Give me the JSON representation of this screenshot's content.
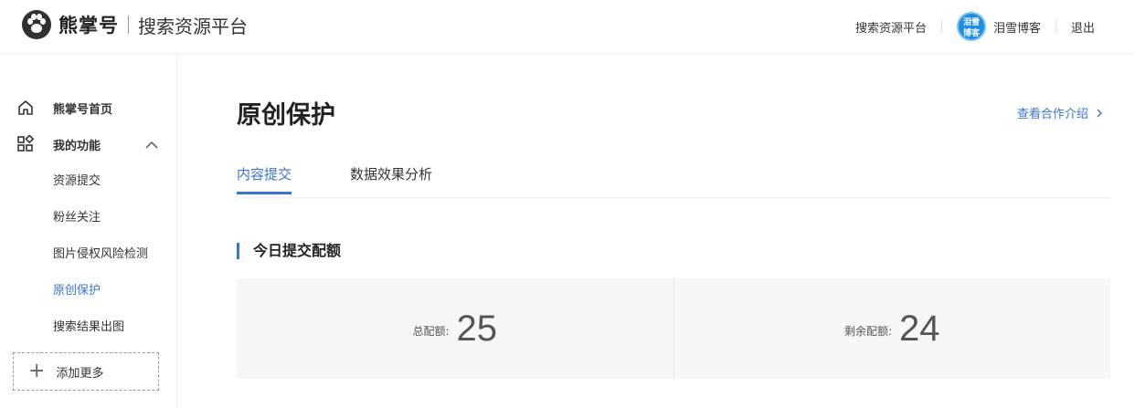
{
  "header": {
    "brand": "熊掌号",
    "platform": "搜索资源平台",
    "links": {
      "platform": "搜索资源平台",
      "logout": "退出"
    },
    "user": {
      "name": "泪雪博客",
      "avatar_text": "泪雪博客"
    }
  },
  "sidebar": {
    "home": "熊掌号首页",
    "my_features": "我的功能",
    "sub_items": [
      "资源提交",
      "粉丝关注",
      "图片侵权风险检测",
      "原创保护",
      "搜索结果出图"
    ],
    "active_index": 3,
    "add_more": "添加更多"
  },
  "main": {
    "title": "原创保护",
    "coop_link": "查看合作介绍",
    "tabs": [
      "内容提交",
      "数据效果分析"
    ],
    "active_tab": 0,
    "section_title": "今日提交配额",
    "quota": {
      "total_label": "总配额:",
      "total_value": "25",
      "remaining_label": "剩余配额:",
      "remaining_value": "24"
    }
  },
  "colors": {
    "accent": "#3a72d8",
    "panel": "#f7f7f7"
  }
}
